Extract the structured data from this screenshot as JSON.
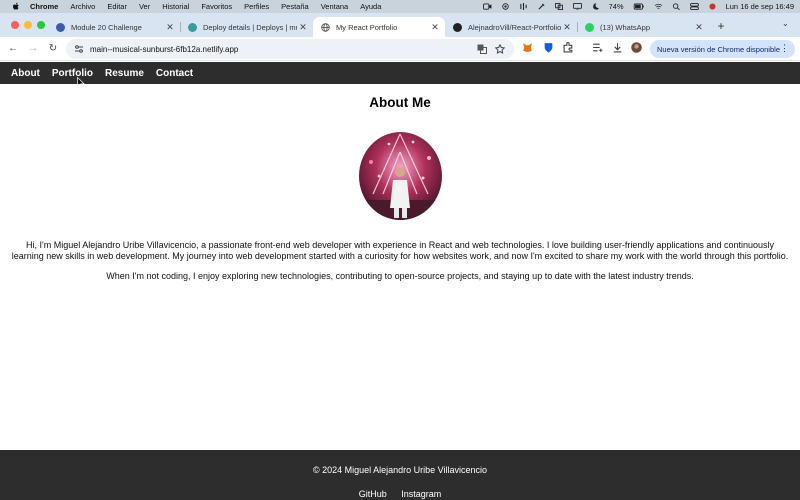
{
  "menubar": {
    "items": [
      "Chrome",
      "Archivo",
      "Editar",
      "Ver",
      "Historial",
      "Favoritos",
      "Perfiles",
      "Pestaña",
      "Ventana",
      "Ayuda"
    ],
    "battery": "74%",
    "clock": "Lun 16 de sep  16:49"
  },
  "tabs": [
    {
      "title": "Module 20 Challenge",
      "icon": "blackboard-icon",
      "color": "#3b5bab"
    },
    {
      "title": "Deploy details | Deploys | musi",
      "icon": "netlify-icon",
      "color": "#3a9b9b"
    },
    {
      "title": "My React Portfolio",
      "icon": "globe-icon",
      "color": "#555555"
    },
    {
      "title": "AlejnadroVill/React-Portfolio",
      "icon": "github-icon",
      "color": "#222222"
    },
    {
      "title": "(13) WhatsApp",
      "icon": "whatsapp-icon",
      "color": "#25d366"
    }
  ],
  "toolbar": {
    "url": "main--musical-sunburst-6fb12a.netlify.app",
    "update_label": "Nueva versión de Chrome disponible"
  },
  "site": {
    "nav": [
      "About",
      "Portfolio",
      "Resume",
      "Contact"
    ],
    "heading": "About Me",
    "para1": "Hi, I'm Miguel Alejandro Uribe Villavicencio, a passionate front-end web developer with experience in React and web technologies. I love building user-friendly applications and continuously learning new skills in web development. My journey into web development started with a curiosity for how websites work, and now I'm excited to share my work with the world through this portfolio.",
    "para2": "When I'm not coding, I enjoy exploring new technologies, contributing to open-source projects, and staying up to date with the latest industry trends.",
    "footer_copy": "© 2024 Miguel Alejandro Uribe Villavicencio",
    "footer_links": [
      "GitHub",
      "Instagram"
    ]
  },
  "colors": {
    "nav_bg": "#2d2d2d",
    "tabstrip_bg": "#d9e4f2",
    "update_btn_bg": "#d4e3fc"
  }
}
